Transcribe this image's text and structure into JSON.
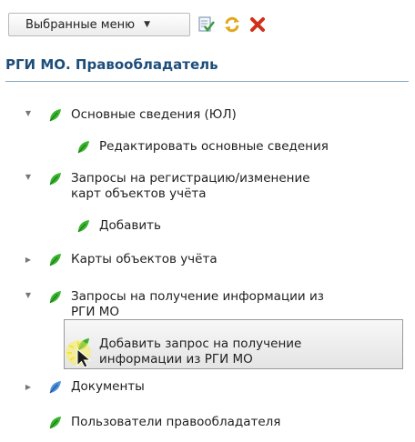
{
  "toolbar": {
    "menu_label": "Выбранные меню",
    "icons": [
      "checklist-edit-icon",
      "refresh-icon",
      "close-icon"
    ],
    "colors": {
      "close": "#d0311b",
      "refresh": "#e2a81c",
      "check": "#3a9a3a"
    }
  },
  "panel": {
    "title": "РГИ МО. Правообладатель"
  },
  "tree": {
    "items": [
      {
        "label": "Основные сведения (ЮЛ)",
        "expander": "expanded"
      },
      {
        "label": "Редактировать основные сведения",
        "expander": "none"
      },
      {
        "label": "Запросы на регистрацию/изменение",
        "label2": "карт объектов учёта",
        "expander": "expanded"
      },
      {
        "label": "Добавить",
        "expander": "none"
      },
      {
        "label": "Карты объектов учёта",
        "expander": "collapsed"
      },
      {
        "label": "Запросы на получение информации из",
        "label2": "РГИ МО",
        "expander": "expanded"
      },
      {
        "label": "Добавить запрос на получение",
        "label2": "информации из РГИ МО",
        "expander": "none",
        "selected": true
      },
      {
        "label": "Документы",
        "expander": "collapsed",
        "icon": "blue"
      },
      {
        "label": "Пользователи правообладателя",
        "expander": "none"
      }
    ]
  }
}
